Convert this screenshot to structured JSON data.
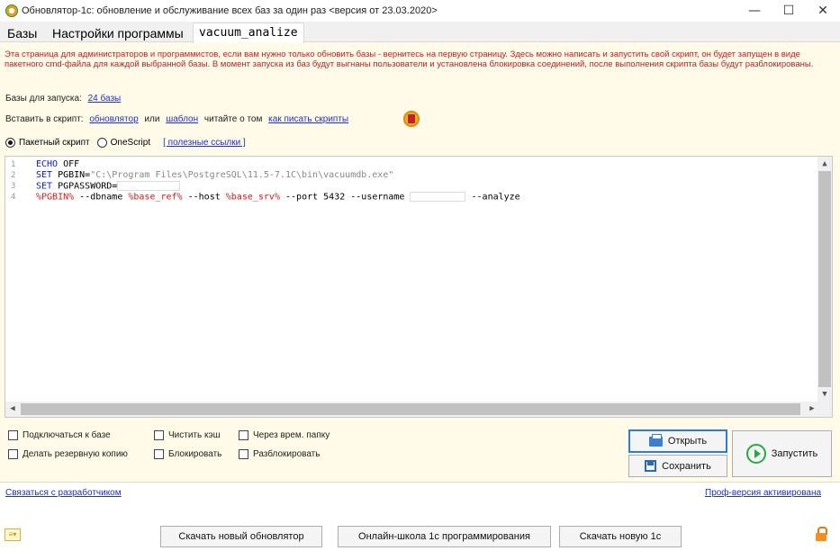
{
  "window": {
    "title": "Обновлятор-1с: обновление и обслуживание всех баз за один раз <версия от 23.03.2020>",
    "minimize": "—",
    "maximize": "☐",
    "close": "✕"
  },
  "tabs": [
    {
      "label": "Базы"
    },
    {
      "label": "Настройки программы"
    },
    {
      "label": "vacuum_analize"
    }
  ],
  "info_text": "Эта страница для администраторов и программистов, если вам нужно только обновить базы - вернитесь на первую страницу. Здесь можно написать и запустить свой скрипт, он будет запущен в виде пакетного cmd-файла для каждой выбранной базы. В момент запуска из баз будут выгнаны пользователи и установлена блокировка соединений, после выполнения скрипта базы будут разблокированы.",
  "bases": {
    "label": "Базы для запуска:",
    "link": "24 базы"
  },
  "insert": {
    "label": "Вставить в скрипт:",
    "link1": "обновлятор",
    "or": "или",
    "link2": "шаблон",
    "read_label": "читайте о том",
    "link3": "как писать скрипты",
    "icon": "book-icon"
  },
  "script_type": {
    "option1": "Пакетный скрипт",
    "option2": "OneScript",
    "selected": "Пакетный скрипт",
    "links": "[ полезные ссылки ]"
  },
  "editor": {
    "line_numbers": [
      "1",
      "2",
      "3",
      "4"
    ],
    "line1_kw": "ECHO",
    "line1_rest": " OFF",
    "line2_kw": "SET",
    "line2_var": " PGBIN=",
    "line2_str": "\"C:\\Program Files\\PostgreSQL\\11.5-7.1C\\bin\\vacuumdb.exe\"",
    "line3_kw": "SET",
    "line3_var": " PGPASSWORD=",
    "line4_v1": "%PGBIN%",
    "line4_t1": " --dbname ",
    "line4_v2": "%base_ref%",
    "line4_t2": " --host ",
    "line4_v3": "%base_srv%",
    "line4_t3": " --port 5432 --username ",
    "line4_t4": " --analyze"
  },
  "options": {
    "connect": "Подключаться к базе",
    "clear_cache": "Чистить кэш",
    "temp_folder": "Через врем. папку",
    "backup": "Делать резервную копию",
    "block": "Блокировать",
    "unblock": "Разблокировать"
  },
  "buttons": {
    "open": "Открыть",
    "save": "Сохранить",
    "run": "Запустить"
  },
  "footer": {
    "contact": "Связаться с разработчиком",
    "pro": "Проф-версия активирована",
    "download_updater": "Скачать новый обновлятор",
    "school": "Онлайн-школа 1с программирования",
    "download_1c": "Скачать новую 1с"
  },
  "colors": {
    "info_text": "#c62020",
    "link": "#1f2fd0",
    "panel_bg": "#fffbe8",
    "run_accent": "#2aa84a"
  }
}
